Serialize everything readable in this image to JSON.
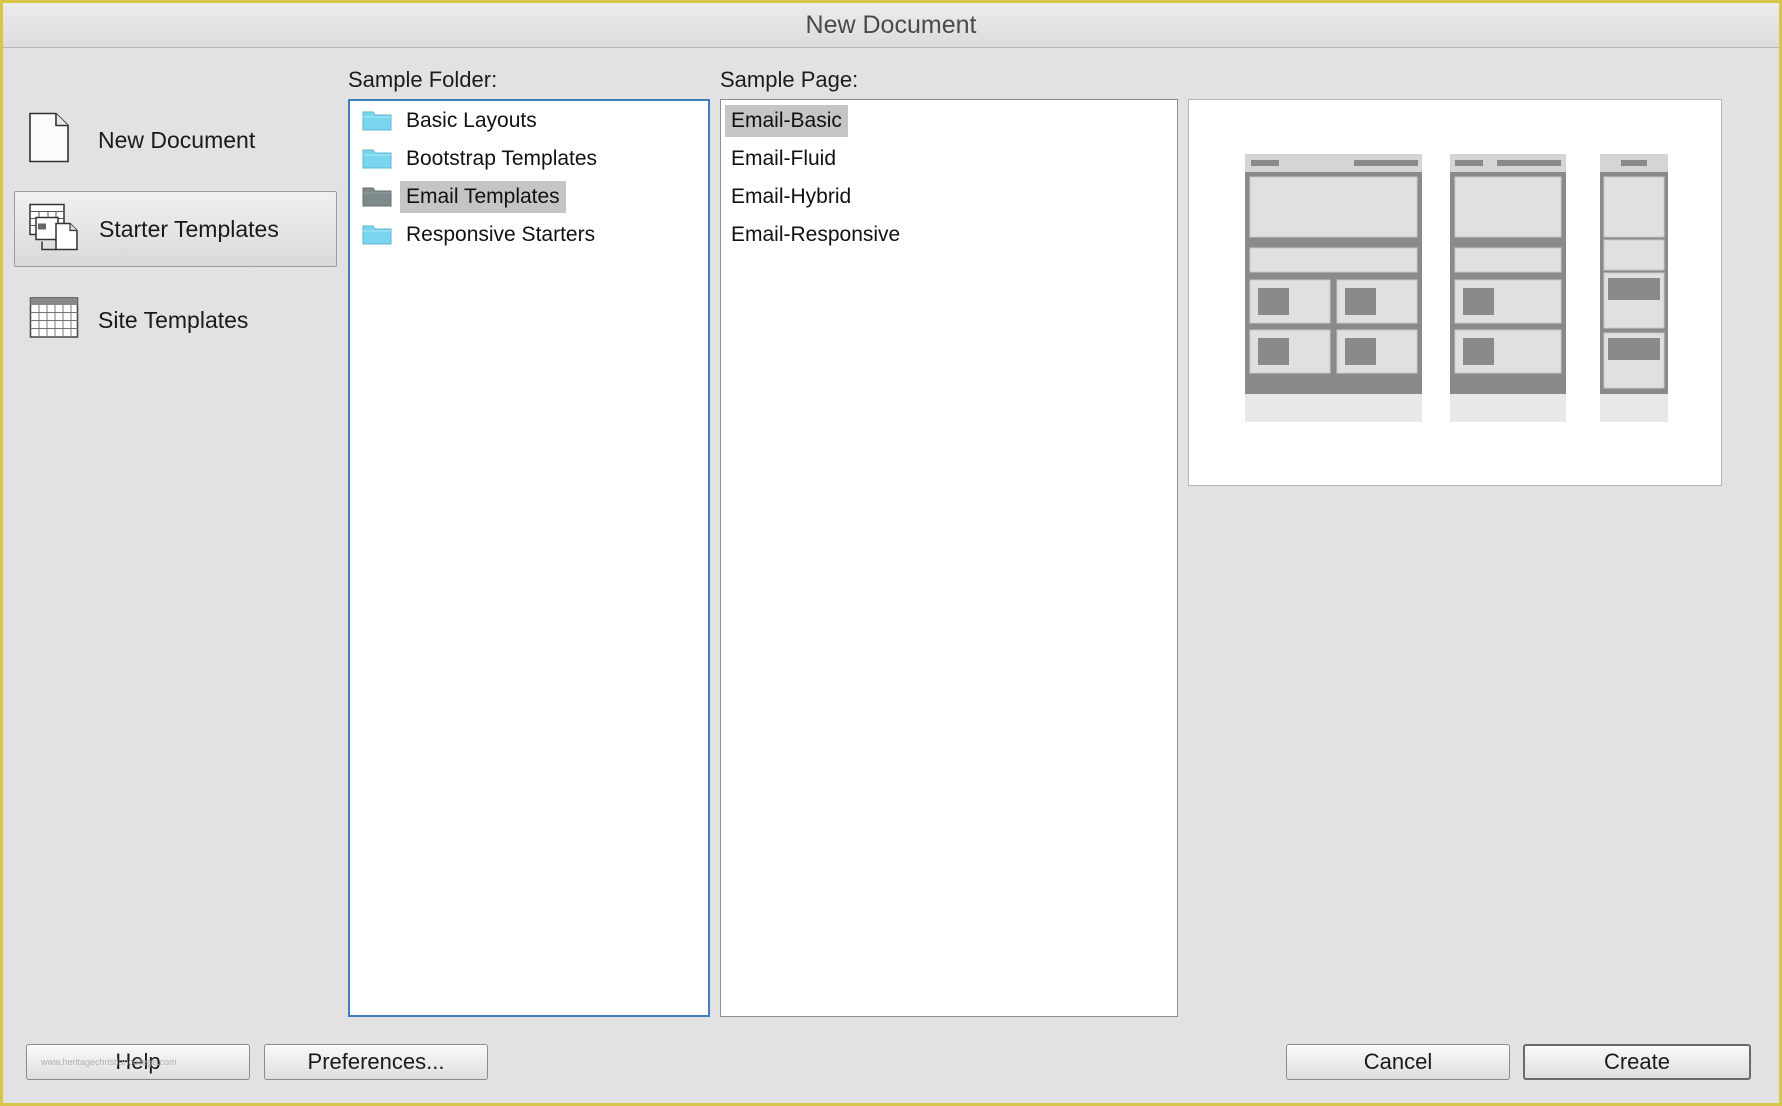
{
  "window": {
    "title": "New Document"
  },
  "categories": [
    {
      "label": "New Document",
      "icon": "blank-document-icon",
      "selected": false
    },
    {
      "label": "Starter Templates",
      "icon": "starter-templates-icon",
      "selected": true
    },
    {
      "label": "Site Templates",
      "icon": "site-templates-icon",
      "selected": false
    }
  ],
  "sample_folder": {
    "label": "Sample Folder:",
    "items": [
      {
        "label": "Basic Layouts",
        "icon": "folder-icon",
        "selected": false
      },
      {
        "label": "Bootstrap Templates",
        "icon": "folder-icon",
        "selected": false
      },
      {
        "label": "Email Templates",
        "icon": "folder-icon",
        "selected": true
      },
      {
        "label": "Responsive Starters",
        "icon": "folder-icon",
        "selected": false
      }
    ]
  },
  "sample_page": {
    "label": "Sample Page:",
    "items": [
      {
        "label": "Email-Basic",
        "selected": true
      },
      {
        "label": "Email-Fluid",
        "selected": false
      },
      {
        "label": "Email-Hybrid",
        "selected": false
      },
      {
        "label": "Email-Responsive",
        "selected": false
      }
    ]
  },
  "footer": {
    "help_label": "Help",
    "watermark": "www.heritagechristiancollege.com",
    "preferences_label": "Preferences...",
    "cancel_label": "Cancel",
    "create_label": "Create"
  },
  "colors": {
    "folder_icon": "#7ad6ee",
    "folder_icon_selected": "#7e8a8c",
    "selection": "#c5c5c5",
    "focus_border": "#3f7fbf",
    "window_border": "#d8c64a"
  }
}
